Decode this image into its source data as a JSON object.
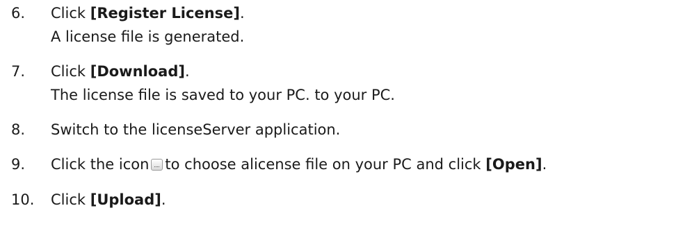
{
  "steps": [
    {
      "num": "6.",
      "pre": "Click ",
      "bold": "[Register License]",
      "post": ".",
      "sub": "A license file is generated."
    },
    {
      "num": "7.",
      "pre": "Click ",
      "bold": "[Download]",
      "post": ".",
      "sub": "The license file is saved to your PC. to your PC."
    },
    {
      "num": "8.",
      "text": "Switch to the licenseServer application."
    },
    {
      "num": "9.",
      "pre": "Click the icon",
      "icon": "browse-button-icon",
      "mid": "to choose alicense file on your PC and click ",
      "bold": "[Open]",
      "post": "."
    },
    {
      "num": "10.",
      "pre": "Click ",
      "bold": "[Upload]",
      "post": "."
    }
  ]
}
